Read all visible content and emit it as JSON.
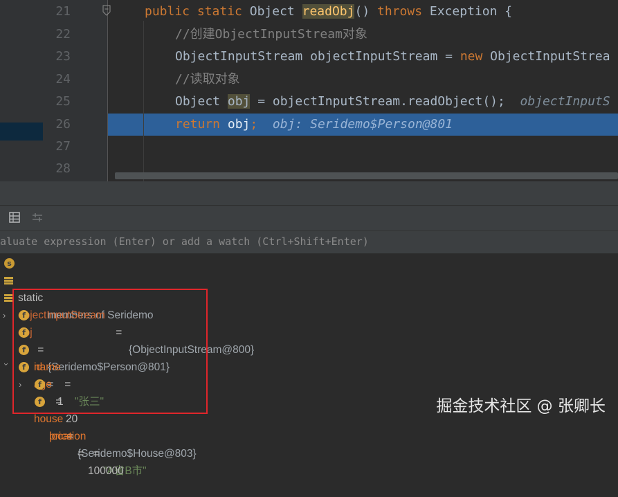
{
  "editor": {
    "line_numbers": [
      "21",
      "22",
      "23",
      "24",
      "25",
      "26",
      "27",
      "28"
    ],
    "line21": {
      "kw1": "public",
      "kw2": "static",
      "t1": "Object",
      "method": "readObj",
      "t2": "()",
      "kw3": "throws",
      "t3": "Exception {"
    },
    "line22": {
      "comment": "//创建ObjectInputStream对象"
    },
    "line23": {
      "t1": "ObjectInputStream objectInputStream = ",
      "kw": "new",
      "t2": "ObjectInputStrea"
    },
    "line24": {
      "comment": "//读取对象"
    },
    "line25": {
      "t1": "Object ",
      "var": "obj",
      "t2": " = objectInputStream.readObject();",
      "kw": ";",
      "hint": "objectInputS"
    },
    "line26": {
      "kw": "return",
      "t1": "obj",
      "semi": ";",
      "hint": "obj: Seridemo$Person@801"
    }
  },
  "evaluate": {
    "placeholder": "aluate expression (Enter) or add a watch (Ctrl+Shift+Enter)"
  },
  "variables": [
    {
      "badge": "s",
      "name": "static",
      "value": "members of Seridemo"
    },
    {
      "name": "objectInputStream",
      "eq": " = ",
      "value": "{ObjectInputStream@800}"
    },
    {
      "name": "obj",
      "eq": " = ",
      "value": "{Seridemo$Person@801}"
    },
    {
      "badge": "f",
      "name": "name",
      "eq": " = ",
      "value": "\"张三\""
    },
    {
      "badge": "f",
      "name": "id",
      "eq": " = ",
      "value": "1"
    },
    {
      "badge": "f",
      "name": "age",
      "eq": " = ",
      "value": "20"
    },
    {
      "badge": "f",
      "name": "house",
      "eq": " = ",
      "value": "{Seridemo$House@803}"
    },
    {
      "badge": "f",
      "name": "location",
      "eq": " = ",
      "value": "\"A省B市\""
    },
    {
      "badge": "f",
      "name": "price",
      "eq": " = ",
      "value": "100000"
    }
  ],
  "watermark": "掘金技术社区 @ 张卿长",
  "colors": {
    "keyword": "#cc7832",
    "method": "#ffc66d",
    "comment": "#808080",
    "highlight": "#2d6099",
    "field_badge": "#d8a43b",
    "string": "#6a8759",
    "red_box": "#e0262b"
  }
}
